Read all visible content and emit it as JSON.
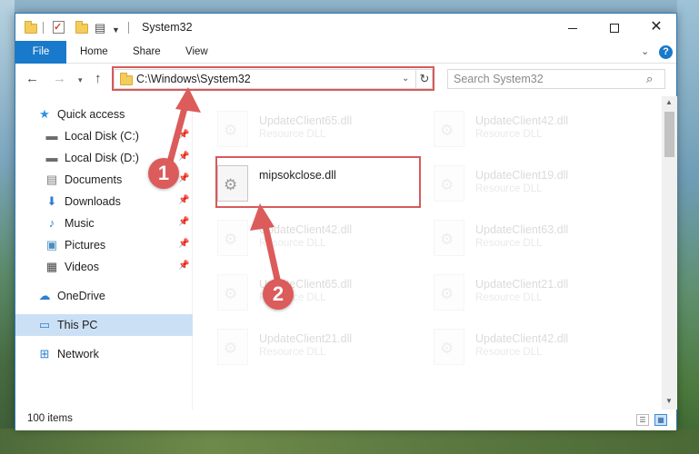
{
  "window": {
    "title": "System32",
    "min_label": "",
    "close_label": "✕"
  },
  "ribbon": {
    "tabs": [
      "File",
      "Home",
      "Share",
      "View"
    ]
  },
  "address": {
    "path": "C:\\Windows\\System32"
  },
  "search": {
    "placeholder": "Search System32"
  },
  "sidebar": {
    "items": [
      {
        "label": "Quick access",
        "icon": "star-icon",
        "pinned": false
      },
      {
        "label": "Local Disk (C:)",
        "icon": "drive-icon",
        "pinned": true
      },
      {
        "label": "Local Disk (D:)",
        "icon": "drive-icon",
        "pinned": true
      },
      {
        "label": "Documents",
        "icon": "documents-icon",
        "pinned": true
      },
      {
        "label": "Downloads",
        "icon": "downloads-icon",
        "pinned": true
      },
      {
        "label": "Music",
        "icon": "music-icon",
        "pinned": true
      },
      {
        "label": "Pictures",
        "icon": "pictures-icon",
        "pinned": true
      },
      {
        "label": "Videos",
        "icon": "videos-icon",
        "pinned": true
      },
      {
        "label": "OneDrive",
        "icon": "cloud-icon",
        "pinned": false
      },
      {
        "label": "This PC",
        "icon": "computer-icon",
        "pinned": false,
        "selected": true
      },
      {
        "label": "Network",
        "icon": "network-icon",
        "pinned": false
      }
    ]
  },
  "files": [
    {
      "name": "UpdateClient65.dll",
      "type": "Resource DLL",
      "faded": true
    },
    {
      "name": "UpdateClient42.dll",
      "type": "Resource DLL",
      "faded": true
    },
    {
      "name": "mipsokclose.dll",
      "type": "",
      "faded": false
    },
    {
      "name": "UpdateClient19.dll",
      "type": "Resource DLL",
      "faded": true
    },
    {
      "name": "UpdateClient42.dll",
      "type": "Resource DLL",
      "faded": true
    },
    {
      "name": "UpdateClient63.dll",
      "type": "Resource DLL",
      "faded": true
    },
    {
      "name": "UpdateClient65.dll",
      "type": "Resource DLL",
      "faded": true
    },
    {
      "name": "UpdateClient21.dll",
      "type": "Resource DLL",
      "faded": true
    },
    {
      "name": "UpdateClient21.dll",
      "type": "Resource DLL",
      "faded": true
    },
    {
      "name": "UpdateClient42.dll",
      "type": "Resource DLL",
      "faded": true
    }
  ],
  "status": {
    "item_count": "100 items"
  },
  "annotations": {
    "step1": "1",
    "step2": "2"
  },
  "colors": {
    "accent": "#1979ca",
    "highlight": "#d65a5a",
    "selection": "#cce0f5"
  }
}
